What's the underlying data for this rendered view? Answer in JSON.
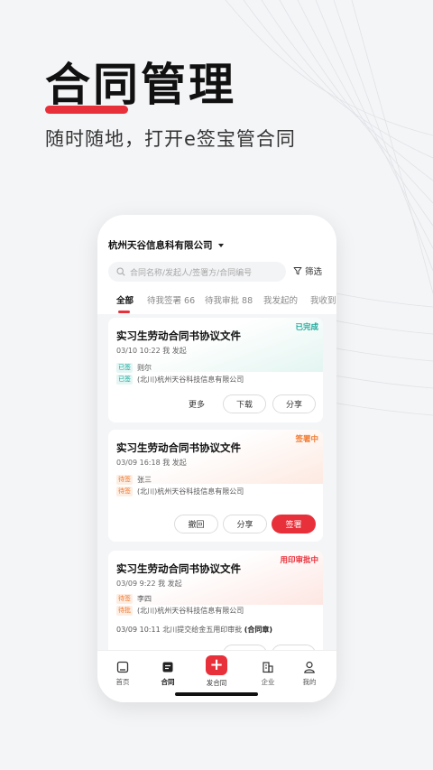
{
  "hero": {
    "title": "合同管理",
    "subtitle": "随时随地，打开e签宝管合同"
  },
  "colors": {
    "accent": "#e8303a",
    "success": "#1aa89a",
    "warning": "#f07b32",
    "background": "#f4f5f7"
  },
  "app": {
    "company": "杭州天谷信息科有限公司",
    "search_placeholder": "合同名称/发起人/签署方/合同编号",
    "filter_label": "筛选",
    "tabs": [
      {
        "label": "全部"
      },
      {
        "label": "待我签署 66"
      },
      {
        "label": "待我审批 88"
      },
      {
        "label": "我发起的"
      },
      {
        "label": "我收到"
      }
    ],
    "active_tab": "全部",
    "cards": [
      {
        "status": "已完成",
        "title": "实习生劳动合同书协议文件",
        "meta": "03/10 10:22  我 发起",
        "parties": [
          {
            "badge": "已签",
            "name": "则尔"
          },
          {
            "badge": "已签",
            "name": "(北川)杭州天谷科技信息有限公司"
          }
        ],
        "buttons": [
          "更多",
          "下载",
          "分享"
        ]
      },
      {
        "status": "签署中",
        "title": "实习生劳动合同书协议文件",
        "meta": "03/09 16:18  我 发起",
        "parties": [
          {
            "badge": "待签",
            "name": "张三"
          },
          {
            "badge": "待签",
            "name": "(北川)杭州天谷科技信息有限公司"
          }
        ],
        "buttons": [
          "撤回",
          "分享",
          "签署"
        ]
      },
      {
        "status": "用印审批中",
        "title": "实习生劳动合同书协议文件",
        "meta": "03/09 9:22  我 发起",
        "parties": [
          {
            "badge": "待签",
            "name": "李四"
          },
          {
            "badge": "待批",
            "name": "(北川)杭州天谷科技信息有限公司"
          }
        ],
        "extra_prefix": "03/09 10:11  北川提交给金五用印审批",
        "extra_bold": "(合同章)"
      }
    ],
    "tabbar": {
      "home": "首页",
      "contracts": "合同",
      "create": "发合同",
      "enterprise": "企业",
      "mine": "我的"
    }
  }
}
